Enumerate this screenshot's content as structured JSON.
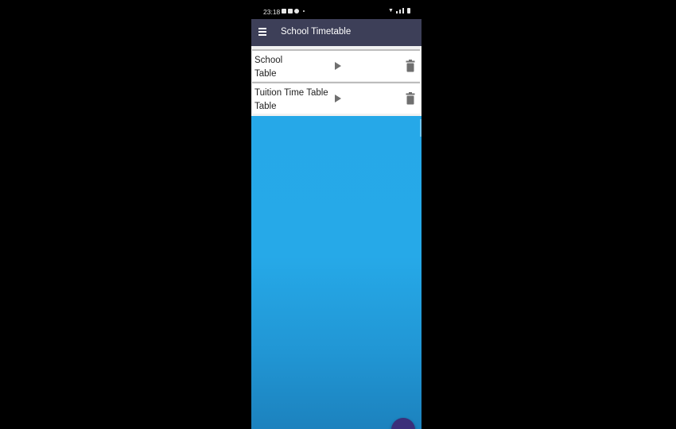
{
  "status_bar": {
    "time": "23:18"
  },
  "app_bar": {
    "title": "School Timetable"
  },
  "timetables": [
    {
      "name_line1": "School",
      "name_line2": "Table"
    },
    {
      "name_line1": "Tuition Time Table",
      "name_line2": "Table"
    }
  ],
  "colors": {
    "app_bar": "#3d3f58",
    "background": "#26a8e8",
    "fab": "#3b2f7a",
    "icon_gray": "#6f6f6f"
  },
  "icons": {
    "menu": "hamburger-menu-icon",
    "open": "play-arrow-icon",
    "delete": "trash-icon",
    "add": "add-fab"
  }
}
